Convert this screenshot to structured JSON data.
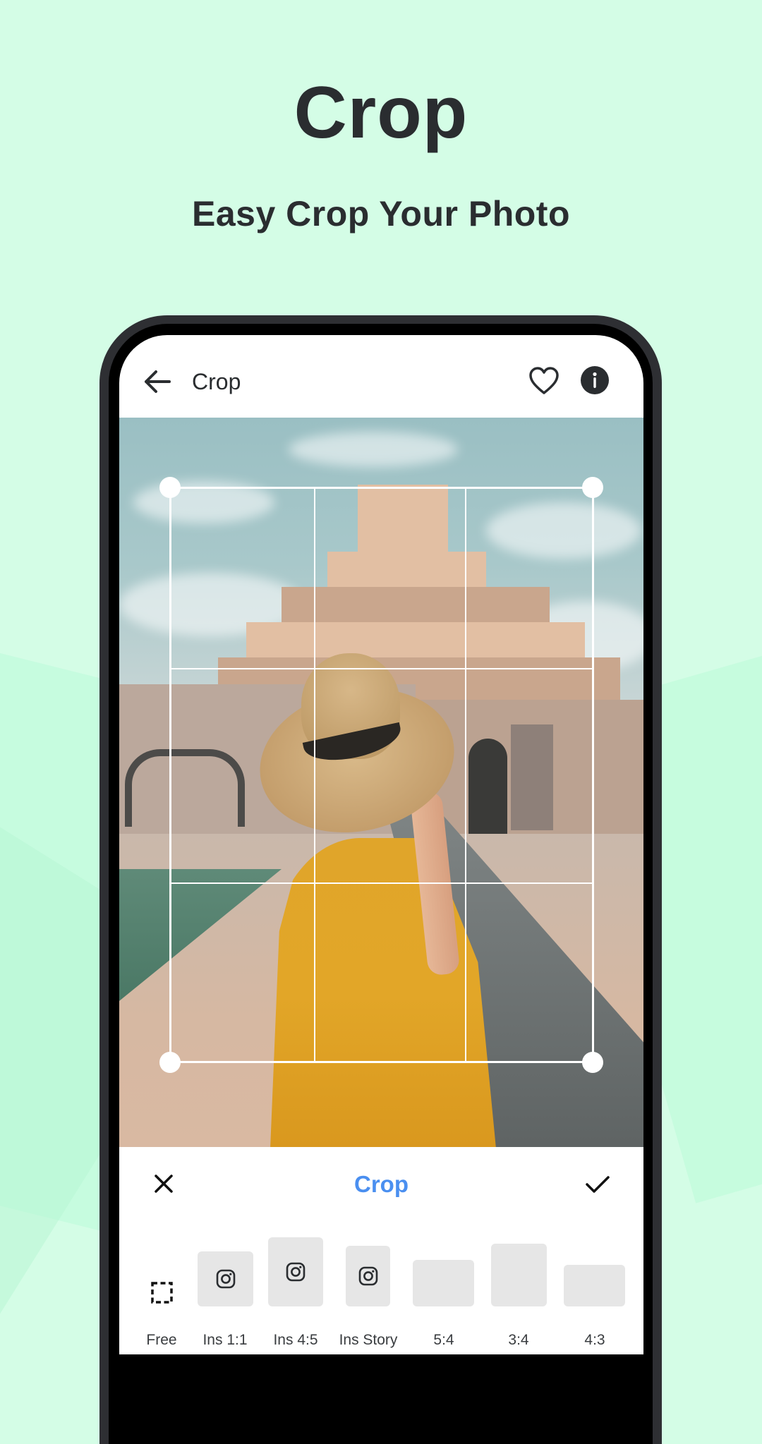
{
  "hero": {
    "title": "Crop",
    "subtitle": "Easy Crop Your Photo"
  },
  "colors": {
    "background": "#D4FDE6",
    "accent": "#4A8FF0",
    "text_dark": "#2A2D30",
    "ratio_box": "#E6E6E6"
  },
  "app": {
    "topbar": {
      "title": "Crop",
      "back_icon": "arrow-left-icon",
      "favorite_icon": "heart-outline-icon",
      "info_icon": "info-circle-icon"
    },
    "crop_overlay": {
      "grid": "rule-of-thirds",
      "handles": [
        "top-left",
        "top-right",
        "bottom-left",
        "bottom-right"
      ]
    },
    "bottom_panel": {
      "title": "Crop",
      "cancel_icon": "close-icon",
      "confirm_icon": "check-icon",
      "ratios": [
        {
          "label": "Free",
          "icon": "dashed-square-icon"
        },
        {
          "label": "Ins 1:1",
          "icon": "instagram-icon"
        },
        {
          "label": "Ins 4:5",
          "icon": "instagram-icon"
        },
        {
          "label": "Ins Story",
          "icon": "instagram-icon"
        },
        {
          "label": "5:4",
          "icon": ""
        },
        {
          "label": "3:4",
          "icon": ""
        },
        {
          "label": "4:3",
          "icon": ""
        }
      ]
    }
  }
}
